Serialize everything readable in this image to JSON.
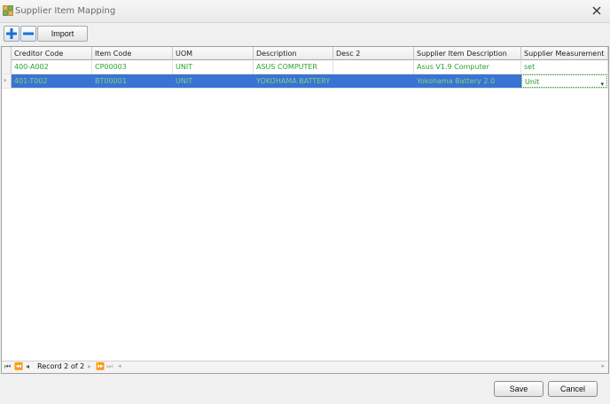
{
  "window": {
    "title": "Supplier Item Mapping"
  },
  "toolbar": {
    "add_icon": "plus-icon",
    "remove_icon": "minus-icon",
    "import_label": "Import"
  },
  "grid": {
    "columns": [
      "Creditor Code",
      "Item Code",
      "UOM",
      "Description",
      "Desc 2",
      "Supplier Item Description",
      "Supplier Measurement"
    ],
    "rows": [
      {
        "creditor_code": "400-A002",
        "item_code": "CP00003",
        "uom": "UNIT",
        "description": "ASUS COMPUTER",
        "desc2": "",
        "supplier_item_description": "Asus V1.9 Computer",
        "supplier_measurement": "set"
      },
      {
        "creditor_code": "401-T002",
        "item_code": "BT00001",
        "uom": "UNIT",
        "description": "YOKOHAMA BATTERY",
        "desc2": "",
        "supplier_item_description": "Yokohama Battery 2.0",
        "supplier_measurement": "Unit"
      }
    ],
    "selected_row": 2
  },
  "navigator": {
    "record_text": "Record 2 of 2"
  },
  "footer": {
    "save_label": "Save",
    "cancel_label": "Cancel"
  },
  "colors": {
    "selection": "#3a73d4",
    "cell_text": "#2ea32e"
  }
}
